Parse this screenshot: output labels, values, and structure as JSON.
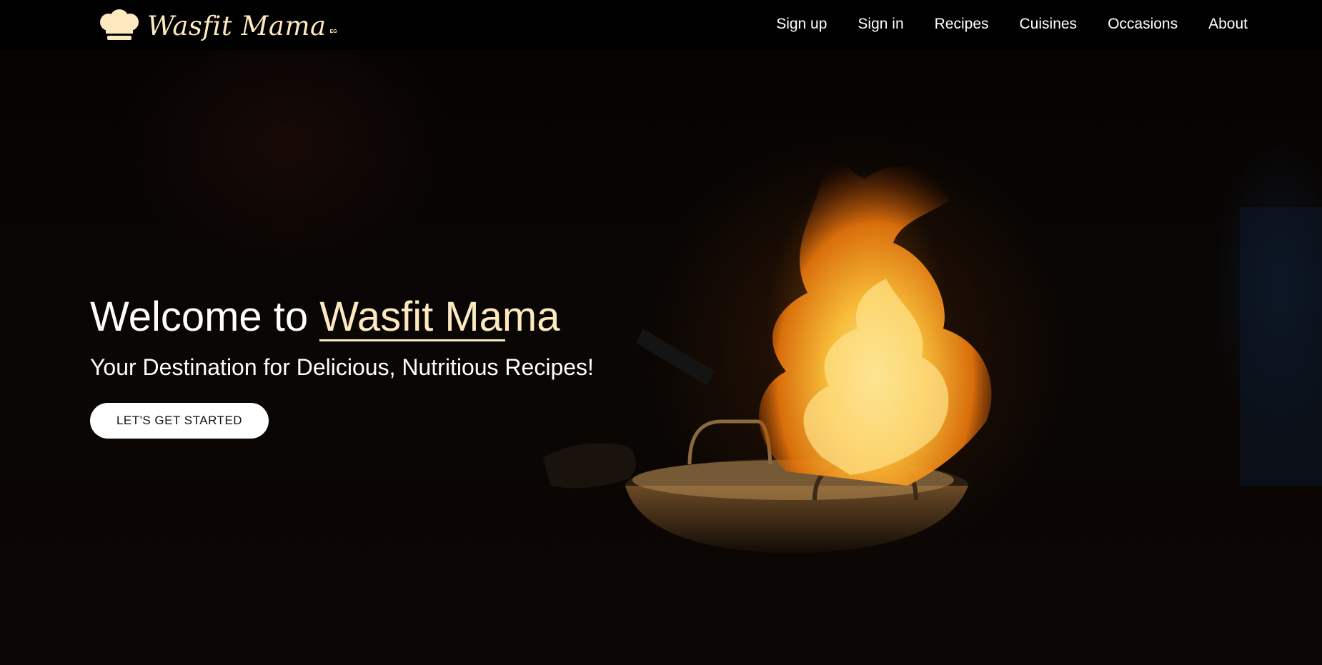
{
  "brand": {
    "name": "Wasfit Mama",
    "suffix": "EG",
    "accent_color": "#fde9bf",
    "logo_icon": "chef-hat-icon"
  },
  "nav": {
    "items": [
      {
        "label": "Sign up"
      },
      {
        "label": "Sign in"
      },
      {
        "label": "Recipes"
      },
      {
        "label": "Cuisines"
      },
      {
        "label": "Occasions"
      },
      {
        "label": "About"
      }
    ]
  },
  "hero": {
    "title_prefix": "Welcome to ",
    "title_brand": "Wasfit Mama",
    "subtitle": "Your Destination for Delicious, Nutritious Recipes!",
    "cta_label": "LET'S GET STARTED",
    "background": "flaming-pan-photo"
  }
}
